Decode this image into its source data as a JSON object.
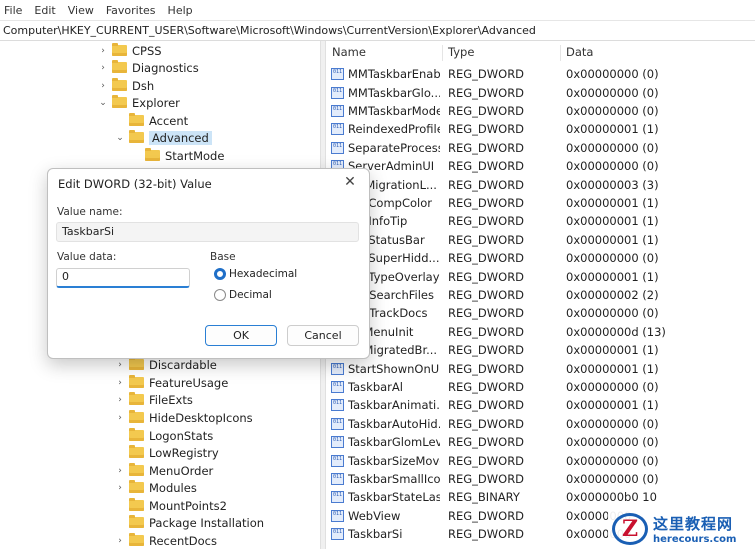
{
  "menu": [
    "File",
    "Edit",
    "View",
    "Favorites",
    "Help"
  ],
  "address": "Computer\\HKEY_CURRENT_USER\\Software\\Microsoft\\Windows\\CurrentVersion\\Explorer\\Advanced",
  "tree": [
    {
      "label": "CPSS",
      "expanded": false,
      "selected": false
    },
    {
      "label": "Diagnostics",
      "expanded": false,
      "selected": false
    },
    {
      "label": "Dsh",
      "expanded": false,
      "selected": false
    },
    {
      "label": "Explorer",
      "expanded": true,
      "selected": false
    },
    {
      "label": "Accent",
      "expanded": false,
      "selected": false
    },
    {
      "label": "Advanced",
      "expanded": true,
      "selected": true
    },
    {
      "label": "StartMode",
      "expanded": false,
      "selected": false
    },
    {
      "label": "Discardable",
      "expanded": false,
      "selected": false
    },
    {
      "label": "FeatureUsage",
      "expanded": false,
      "selected": false
    },
    {
      "label": "FileExts",
      "expanded": false,
      "selected": false
    },
    {
      "label": "HideDesktopIcons",
      "expanded": false,
      "selected": false
    },
    {
      "label": "LogonStats",
      "expanded": false,
      "selected": false
    },
    {
      "label": "LowRegistry",
      "expanded": false,
      "selected": false
    },
    {
      "label": "MenuOrder",
      "expanded": false,
      "selected": false
    },
    {
      "label": "Modules",
      "expanded": false,
      "selected": false
    },
    {
      "label": "MountPoints2",
      "expanded": false,
      "selected": false
    },
    {
      "label": "Package Installation",
      "expanded": false,
      "selected": false
    },
    {
      "label": "RecentDocs",
      "expanded": false,
      "selected": false
    }
  ],
  "list": {
    "headers": {
      "name": "Name",
      "type": "Type",
      "data": "Data"
    },
    "rows": [
      {
        "name": "MMTaskbarEnab...",
        "type": "REG_DWORD",
        "data": "0x00000000 (0)"
      },
      {
        "name": "MMTaskbarGlo...",
        "type": "REG_DWORD",
        "data": "0x00000000 (0)"
      },
      {
        "name": "MMTaskbarMode",
        "type": "REG_DWORD",
        "data": "0x00000000 (0)"
      },
      {
        "name": "ReindexedProfile",
        "type": "REG_DWORD",
        "data": "0x00000001 (1)"
      },
      {
        "name": "SeparateProcess",
        "type": "REG_DWORD",
        "data": "0x00000000 (0)"
      },
      {
        "name": "ServerAdminUI",
        "type": "REG_DWORD",
        "data": "0x00000000 (0)"
      },
      {
        "name": "...llMigrationL...",
        "type": "REG_DWORD",
        "data": "0x00000003 (3)"
      },
      {
        "name": "...wCompColor",
        "type": "REG_DWORD",
        "data": "0x00000001 (1)"
      },
      {
        "name": "...wInfoTip",
        "type": "REG_DWORD",
        "data": "0x00000001 (1)"
      },
      {
        "name": "...wStatusBar",
        "type": "REG_DWORD",
        "data": "0x00000001 (1)"
      },
      {
        "name": "...wSuperHidd...",
        "type": "REG_DWORD",
        "data": "0x00000000 (0)"
      },
      {
        "name": "...wTypeOverlay",
        "type": "REG_DWORD",
        "data": "0x00000001 (1)"
      },
      {
        "name": "...t_SearchFiles",
        "type": "REG_DWORD",
        "data": "0x00000002 (2)"
      },
      {
        "name": "...t_TrackDocs",
        "type": "REG_DWORD",
        "data": "0x00000000 (0)"
      },
      {
        "name": "...tMenuInit",
        "type": "REG_DWORD",
        "data": "0x0000000d (13)"
      },
      {
        "name": "...tMigratedBr...",
        "type": "REG_DWORD",
        "data": "0x00000001 (1)"
      },
      {
        "name": "StartShownOnU...",
        "type": "REG_DWORD",
        "data": "0x00000001 (1)"
      },
      {
        "name": "TaskbarAl",
        "type": "REG_DWORD",
        "data": "0x00000000 (0)"
      },
      {
        "name": "TaskbarAnimati...",
        "type": "REG_DWORD",
        "data": "0x00000001 (1)"
      },
      {
        "name": "TaskbarAutoHid...",
        "type": "REG_DWORD",
        "data": "0x00000000 (0)"
      },
      {
        "name": "TaskbarGlomLevel",
        "type": "REG_DWORD",
        "data": "0x00000000 (0)"
      },
      {
        "name": "TaskbarSizeMove",
        "type": "REG_DWORD",
        "data": "0x00000000 (0)"
      },
      {
        "name": "TaskbarSmallIcons",
        "type": "REG_DWORD",
        "data": "0x00000000 (0)"
      },
      {
        "name": "TaskbarStateLast...",
        "type": "REG_BINARY",
        "data": "0x000000b0 10"
      },
      {
        "name": "WebView",
        "type": "REG_DWORD",
        "data": "0x0000000"
      },
      {
        "name": "TaskbarSi",
        "type": "REG_DWORD",
        "data": "0x0000000"
      }
    ]
  },
  "dialog": {
    "title": "Edit DWORD (32-bit) Value",
    "close_glyph": "✕",
    "value_name_label": "Value name:",
    "value_name": "TaskbarSi",
    "value_data_label": "Value data:",
    "value_data": "0",
    "base_label": "Base",
    "base_options": [
      {
        "label": "Hexadecimal",
        "selected": true
      },
      {
        "label": "Decimal",
        "selected": false
      }
    ],
    "ok_label": "OK",
    "cancel_label": "Cancel"
  },
  "watermark": {
    "logo_letter": "Z",
    "chinese": "这里教程网",
    "site": "herecours.com"
  },
  "icons": {
    "value_icon": "dword-value-icon",
    "folder_icon": "folder-icon",
    "accent": "#2a7fd4"
  }
}
